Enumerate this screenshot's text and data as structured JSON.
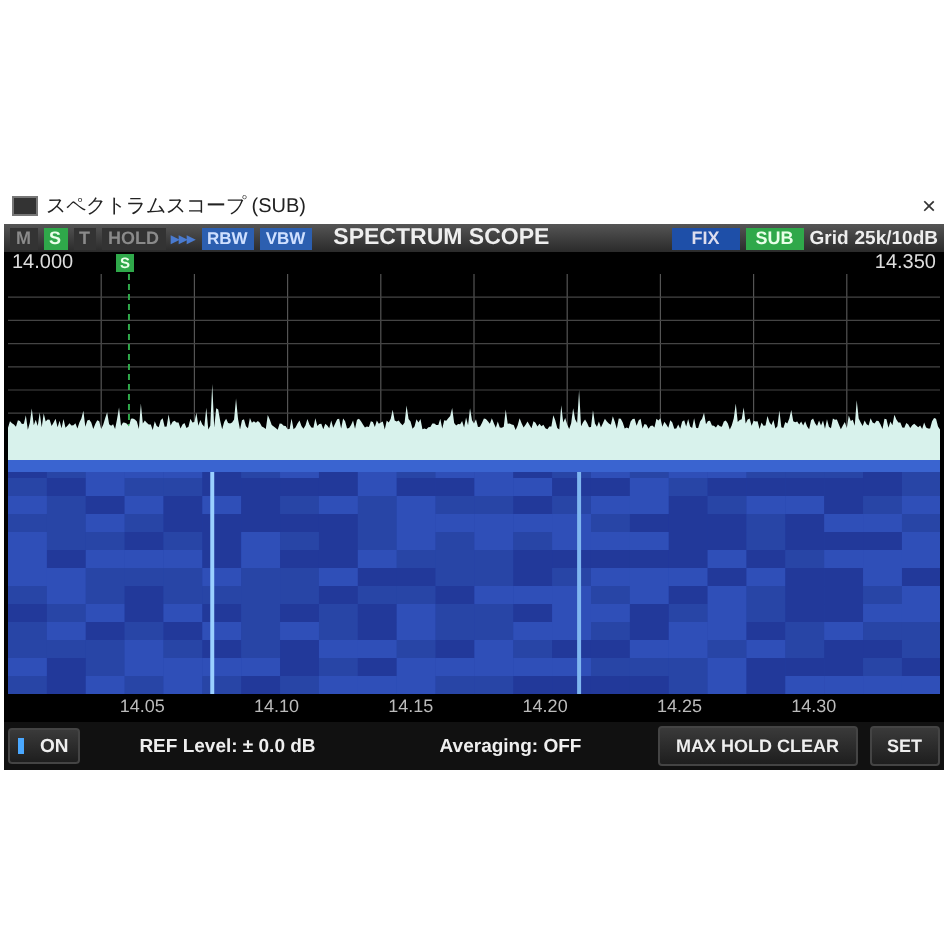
{
  "window": {
    "title": "スペクトラムスコープ (SUB)",
    "close": "×"
  },
  "toolbar": {
    "indicators": [
      {
        "label": "M",
        "on": false
      },
      {
        "label": "S",
        "on": true
      },
      {
        "label": "T",
        "on": false
      },
      {
        "label": "HOLD",
        "on": false
      }
    ],
    "arrows": "▸▸▸",
    "buttons": [
      {
        "label": "RBW"
      },
      {
        "label": "VBW"
      }
    ],
    "title": "SPECTRUM SCOPE",
    "mode": "FIX",
    "band": {
      "label": "SUB",
      "on": true
    },
    "grid_label": "Grid",
    "grid_value": "25k/10dB"
  },
  "scope": {
    "start": "14.000",
    "end": "14.350",
    "marker": "S",
    "x_labels": [
      "14.05",
      "14.10",
      "14.15",
      "14.20",
      "14.25",
      "14.30"
    ]
  },
  "bottom": {
    "on_button": {
      "label": "ON",
      "on": true
    },
    "ref_level": "REF Level: ±  0.0 dB",
    "averaging": "Averaging: OFF",
    "buttons": [
      "MAX HOLD CLEAR",
      "SET"
    ]
  }
}
